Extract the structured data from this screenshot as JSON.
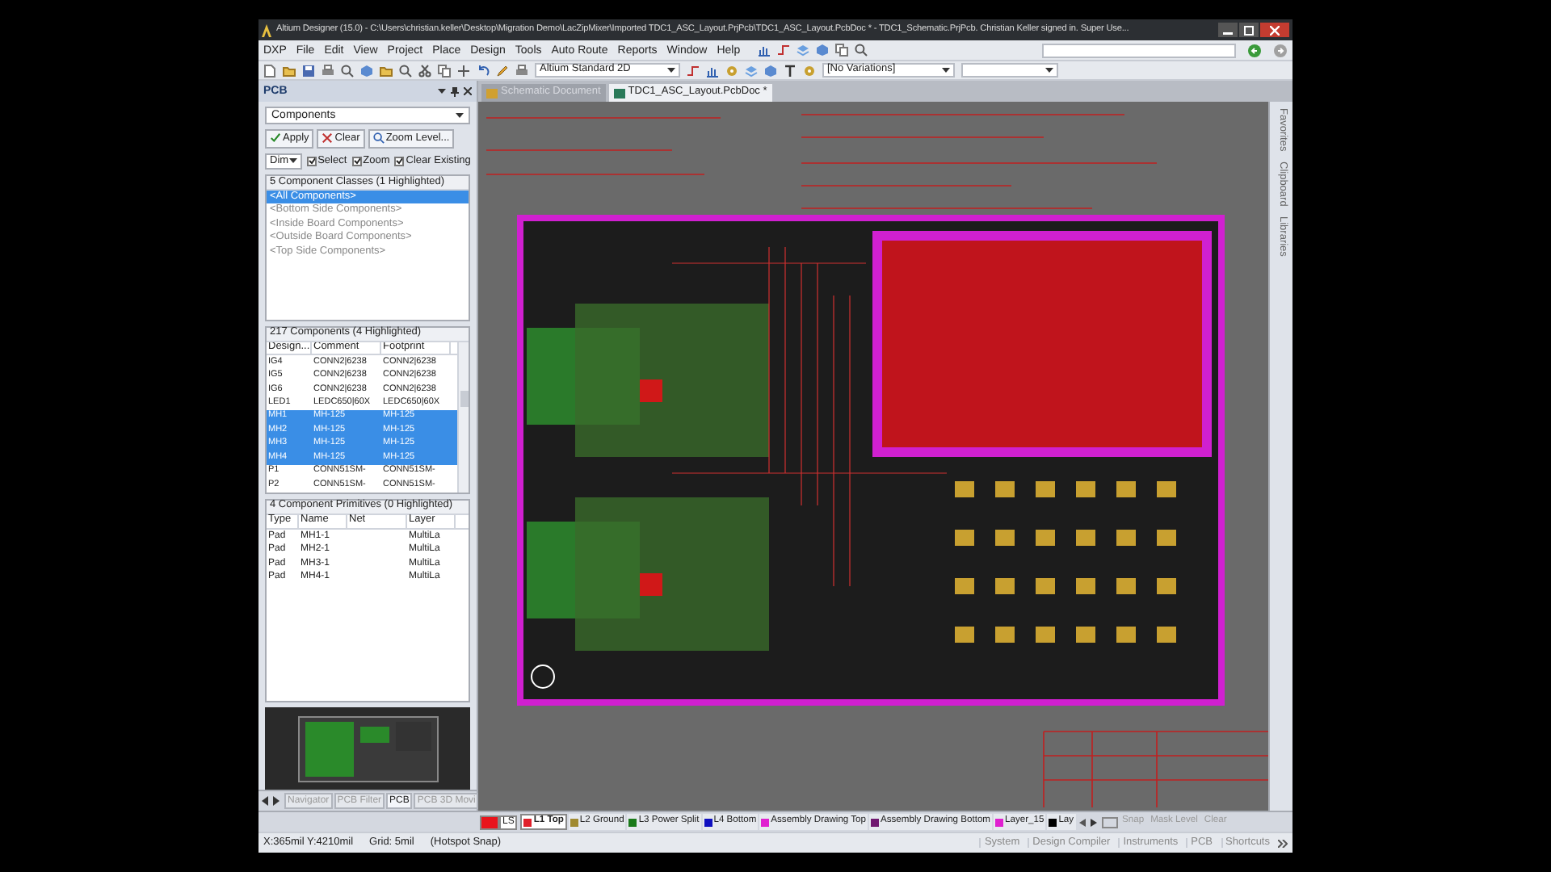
{
  "window": {
    "title": "Altium Designer (15.0) - C:\\Users\\christian.keller\\Desktop\\Migration Demo\\LacZipMixer\\Imported TDC1_ASC_Layout.PrjPcb\\TDC1_ASC_Layout.PcbDoc * - TDC1_Schematic.PrjPcb. Christian Keller signed in. Super Use..."
  },
  "menu": [
    "DXP",
    "File",
    "Edit",
    "View",
    "Project",
    "Place",
    "Design",
    "Tools",
    "Auto Route",
    "Reports",
    "Window",
    "Help"
  ],
  "toolbar": {
    "view_mode": "Altium Standard 2D",
    "variations": "[No Variations]"
  },
  "panel": {
    "title": "PCB",
    "mode": "Components",
    "buttons": [
      "Apply",
      "Clear",
      "Zoom Level..."
    ],
    "dim_mode": "Dim",
    "options": [
      {
        "label": "Select",
        "checked": true
      },
      {
        "label": "Zoom",
        "checked": true
      },
      {
        "label": "Clear Existing",
        "checked": true
      }
    ],
    "classes": {
      "header": "5 Component Classes (1 Highlighted)",
      "items": [
        {
          "label": "<All Components>",
          "selected": true
        },
        {
          "label": "<Bottom Side Components>",
          "selected": false
        },
        {
          "label": "<Inside Board Components>",
          "selected": false
        },
        {
          "label": "<Outside Board Components>",
          "selected": false
        },
        {
          "label": "<Top Side Components>",
          "selected": false
        }
      ]
    },
    "components": {
      "header": "217 Components (4 Highlighted)",
      "columns": [
        "Design...",
        "Comment",
        "Footprint"
      ],
      "rows": [
        {
          "cells": [
            "IG4",
            "CONN2|6238",
            "CONN2|6238"
          ],
          "selected": false
        },
        {
          "cells": [
            "IG5",
            "CONN2|6238",
            "CONN2|6238"
          ],
          "selected": false
        },
        {
          "cells": [
            "IG6",
            "CONN2|6238",
            "CONN2|6238"
          ],
          "selected": false
        },
        {
          "cells": [
            "LED1",
            "LEDC650|60X",
            "LEDC650|60X"
          ],
          "selected": false
        },
        {
          "cells": [
            "MH1",
            "MH-125",
            "MH-125"
          ],
          "selected": true
        },
        {
          "cells": [
            "MH2",
            "MH-125",
            "MH-125"
          ],
          "selected": true
        },
        {
          "cells": [
            "MH3",
            "MH-125",
            "MH-125"
          ],
          "selected": true
        },
        {
          "cells": [
            "MH4",
            "MH-125",
            "MH-125"
          ],
          "selected": true
        },
        {
          "cells": [
            "P1",
            "CONN51SM-",
            "CONN51SM-"
          ],
          "selected": false
        },
        {
          "cells": [
            "P2",
            "CONN51SM-",
            "CONN51SM-"
          ],
          "selected": false
        }
      ]
    },
    "primitives": {
      "header": "4 Component Primitives (0 Highlighted)",
      "columns": [
        "Type",
        "Name",
        "Net",
        "Layer"
      ],
      "rows": [
        [
          "Pad",
          "MH1-1",
          "",
          "MultiLa"
        ],
        [
          "Pad",
          "MH2-1",
          "",
          "MultiLa"
        ],
        [
          "Pad",
          "MH3-1",
          "",
          "MultiLa"
        ],
        [
          "Pad",
          "MH4-1",
          "",
          "MultiLa"
        ]
      ]
    },
    "tabs": [
      {
        "label": "Navigator",
        "selected": false
      },
      {
        "label": "PCB Filter",
        "selected": false
      },
      {
        "label": "PCB",
        "selected": true
      },
      {
        "label": "PCB 3D Movi",
        "selected": false
      }
    ]
  },
  "documents": [
    {
      "label": "Schematic Document",
      "selected": false
    },
    {
      "label": "TDC1_ASC_Layout.PcbDoc *",
      "selected": true
    }
  ],
  "right_sidebar": [
    "Favorites",
    "Clipboard",
    "Libraries"
  ],
  "layers": {
    "current": "LS",
    "tabs": [
      {
        "label": "L1 Top",
        "color": "#e0202a",
        "selected": true
      },
      {
        "label": "L2 Ground",
        "color": "#a08a30",
        "selected": false
      },
      {
        "label": "L3 Power Split",
        "color": "#1a7a1a",
        "selected": false
      },
      {
        "label": "L4 Bottom",
        "color": "#1010c0",
        "selected": false
      },
      {
        "label": "Assembly Drawing Top",
        "color": "#e020d0",
        "selected": false
      },
      {
        "label": "Assembly Drawing Bottom",
        "color": "#701870",
        "selected": false
      },
      {
        "label": "Layer_15",
        "color": "#e020d0",
        "selected": false
      },
      {
        "label": "Lay",
        "color": "#000000",
        "selected": false
      }
    ],
    "buttons": [
      "Snap",
      "Mask Level",
      "Clear"
    ]
  },
  "status_bar": {
    "coordinates": "X:365mil Y:4210mil",
    "grid": "Grid: 5mil",
    "snap": "(Hotspot Snap)",
    "buttons": [
      "System",
      "Design Compiler",
      "Instruments",
      "PCB",
      "Shortcuts"
    ]
  }
}
